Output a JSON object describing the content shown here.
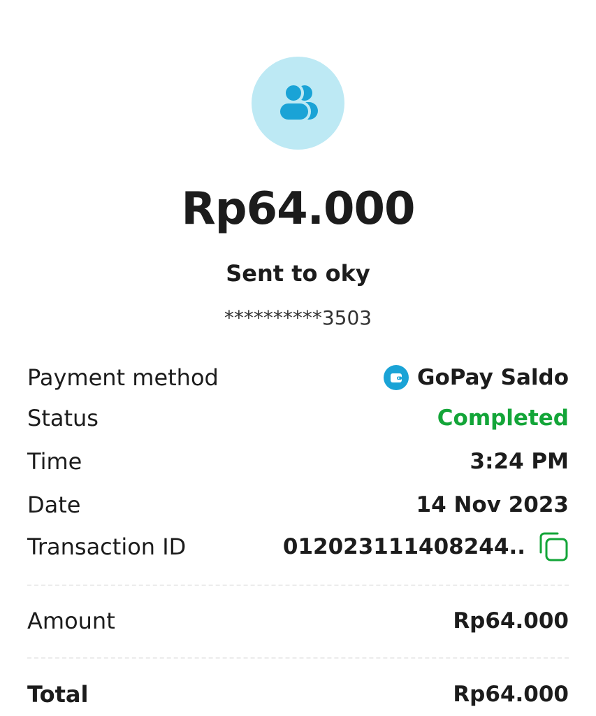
{
  "header": {
    "avatar_icon": "users-group-icon",
    "amount": "Rp64.000",
    "recipient": "Sent to oky",
    "account_masked": "**********3503"
  },
  "details": [
    {
      "key": "payment_method",
      "label": "Payment method",
      "value": "GoPay Saldo",
      "icon": "wallet-icon"
    },
    {
      "key": "status",
      "label": "Status",
      "value": "Completed",
      "color": "#13a538"
    },
    {
      "key": "time",
      "label": "Time",
      "value": "3:24 PM"
    },
    {
      "key": "date",
      "label": "Date",
      "value": "14 Nov 2023"
    },
    {
      "key": "transaction_id",
      "label": "Transaction ID",
      "value": "012023111408244..",
      "action_icon": "copy-icon"
    }
  ],
  "summary": {
    "amount_label": "Amount",
    "amount_value": "Rp64.000",
    "total_label": "Total",
    "total_value": "Rp64.000"
  },
  "colors": {
    "accent_blue": "#1aa3d6",
    "avatar_bg": "#bde9f4",
    "success_green": "#13a538"
  }
}
